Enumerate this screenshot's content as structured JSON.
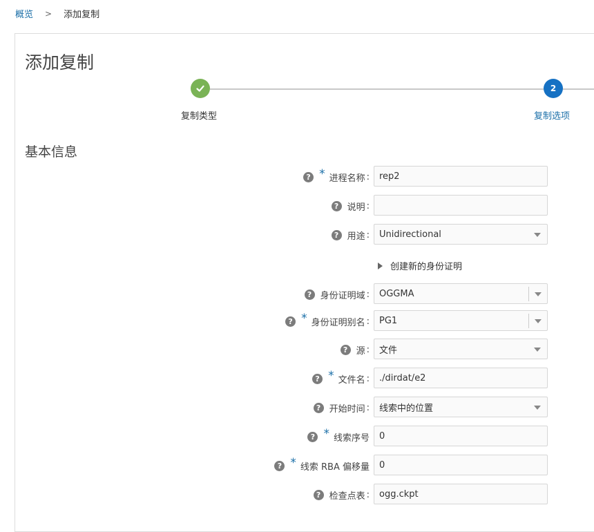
{
  "breadcrumb": {
    "root": "概览",
    "separator": ">",
    "current": "添加复制"
  },
  "page": {
    "title": "添加复制"
  },
  "train": {
    "steps": [
      {
        "label": "复制类型",
        "state": "completed"
      },
      {
        "number": "2",
        "label": "复制选项",
        "state": "active"
      }
    ]
  },
  "section": {
    "title": "基本信息"
  },
  "form": {
    "help_glyph": "?",
    "required_mark": "*",
    "colon": ":",
    "process_name": {
      "label": "进程名称",
      "value": "rep2"
    },
    "description": {
      "label": "说明",
      "value": ""
    },
    "purpose": {
      "label": "用途",
      "value": "Unidirectional"
    },
    "create_credential": {
      "label": "创建新的身份证明"
    },
    "credential_domain": {
      "label": "身份证明域",
      "value": "OGGMA"
    },
    "credential_alias": {
      "label": "身份证明别名",
      "value": "PG1"
    },
    "source": {
      "label": "源",
      "value": "文件"
    },
    "file_name": {
      "label": "文件名",
      "value": "./dirdat/e2"
    },
    "start_time": {
      "label": "开始时间",
      "value": "线索中的位置"
    },
    "trail_sequence": {
      "label": "线索序号",
      "value": "0"
    },
    "trail_rba": {
      "label": "线索 RBA 偏移量",
      "value": "0"
    },
    "checkpoint_table": {
      "label": "检查点表",
      "value": "ogg.ckpt"
    }
  },
  "colors": {
    "accent": "#1671c3",
    "completed": "#7ab356",
    "link": "#1b6fa8"
  }
}
